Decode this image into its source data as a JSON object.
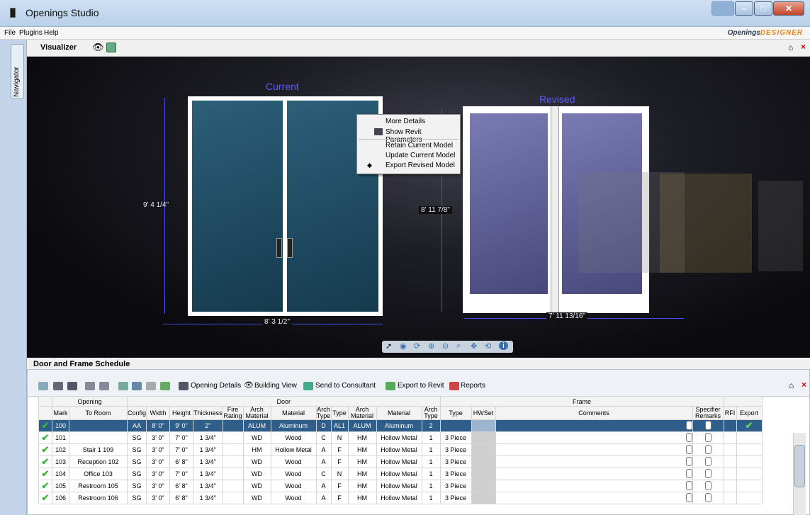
{
  "window": {
    "title": "Openings Studio"
  },
  "menu": {
    "items": [
      "File",
      "Plugins",
      "Help"
    ],
    "brand_a": "Openings",
    "brand_b": "DESIGNER"
  },
  "nav": {
    "tab_label": "Navigator"
  },
  "visualizer": {
    "title": "Visualizer",
    "current_label": "Current",
    "revised_label": "Revised",
    "current_height": "9' 4 1/4\"",
    "current_width": "8' 3 1/2\"",
    "revised_height": "8' 11 7/8\"",
    "revised_width": "7' 11 13/16\""
  },
  "context_menu": [
    "More Details",
    "Show Revit Parameters",
    "Retain Current Model",
    "Update Current Model",
    "Export Revised Model"
  ],
  "schedule": {
    "title": "Door and Frame Schedule",
    "toolbar": [
      "Opening Details",
      "Building View",
      "Send to Consultant",
      "Export to Revit",
      "Reports"
    ],
    "group_headers": {
      "opening": "Opening",
      "door": "Door",
      "frame": "Frame"
    },
    "columns": [
      "Mark",
      "To Room",
      "Config",
      "Width",
      "Height",
      "Thickness",
      "Fire Rating",
      "Arch Material",
      "Material",
      "Arch Type",
      "Type",
      "Arch Material",
      "Material",
      "Arch Type",
      "Type",
      "HWSet",
      "Comments",
      "Specifier Remarks",
      "RFI",
      "Export"
    ],
    "rows": [
      [
        "100",
        "",
        "AA",
        "8' 0\"",
        "9' 0\"",
        "2\"",
        "",
        "ALUM",
        "Aluminum",
        "D",
        "AL1",
        "ALUM",
        "Aluminum",
        "2",
        ""
      ],
      [
        "101",
        "",
        "SG",
        "3' 0\"",
        "7' 0\"",
        "1 3/4\"",
        "",
        "WD",
        "Wood",
        "C",
        "N",
        "HM",
        "Hollow Metal",
        "1",
        "3 Piece"
      ],
      [
        "102",
        "Stair 1 109",
        "SG",
        "3' 0\"",
        "7' 0\"",
        "1 3/4\"",
        "",
        "HM",
        "Hollow Metal",
        "A",
        "F",
        "HM",
        "Hollow Metal",
        "1",
        "3 Piece"
      ],
      [
        "103",
        "Reception 102",
        "SG",
        "3' 0\"",
        "6' 8\"",
        "1 3/4\"",
        "",
        "WD",
        "Wood",
        "A",
        "F",
        "HM",
        "Hollow Metal",
        "1",
        "3 Piece"
      ],
      [
        "104",
        "Office 103",
        "SG",
        "3' 0\"",
        "7' 0\"",
        "1 3/4\"",
        "",
        "WD",
        "Wood",
        "C",
        "N",
        "HM",
        "Hollow Metal",
        "1",
        "3 Piece"
      ],
      [
        "105",
        "Restroom 105",
        "SG",
        "3' 0\"",
        "6' 8\"",
        "1 3/4\"",
        "",
        "WD",
        "Wood",
        "A",
        "F",
        "HM",
        "Hollow Metal",
        "1",
        "3 Piece"
      ],
      [
        "106",
        "Restroom 106",
        "SG",
        "3' 0\"",
        "6' 8\"",
        "1 3/4\"",
        "",
        "WD",
        "Wood",
        "A",
        "F",
        "HM",
        "Hollow Metal",
        "1",
        "3 Piece"
      ]
    ]
  },
  "colors": {
    "accent": "#2f5e8a",
    "dimension": "#4a4aff",
    "check": "#3ab53a"
  }
}
